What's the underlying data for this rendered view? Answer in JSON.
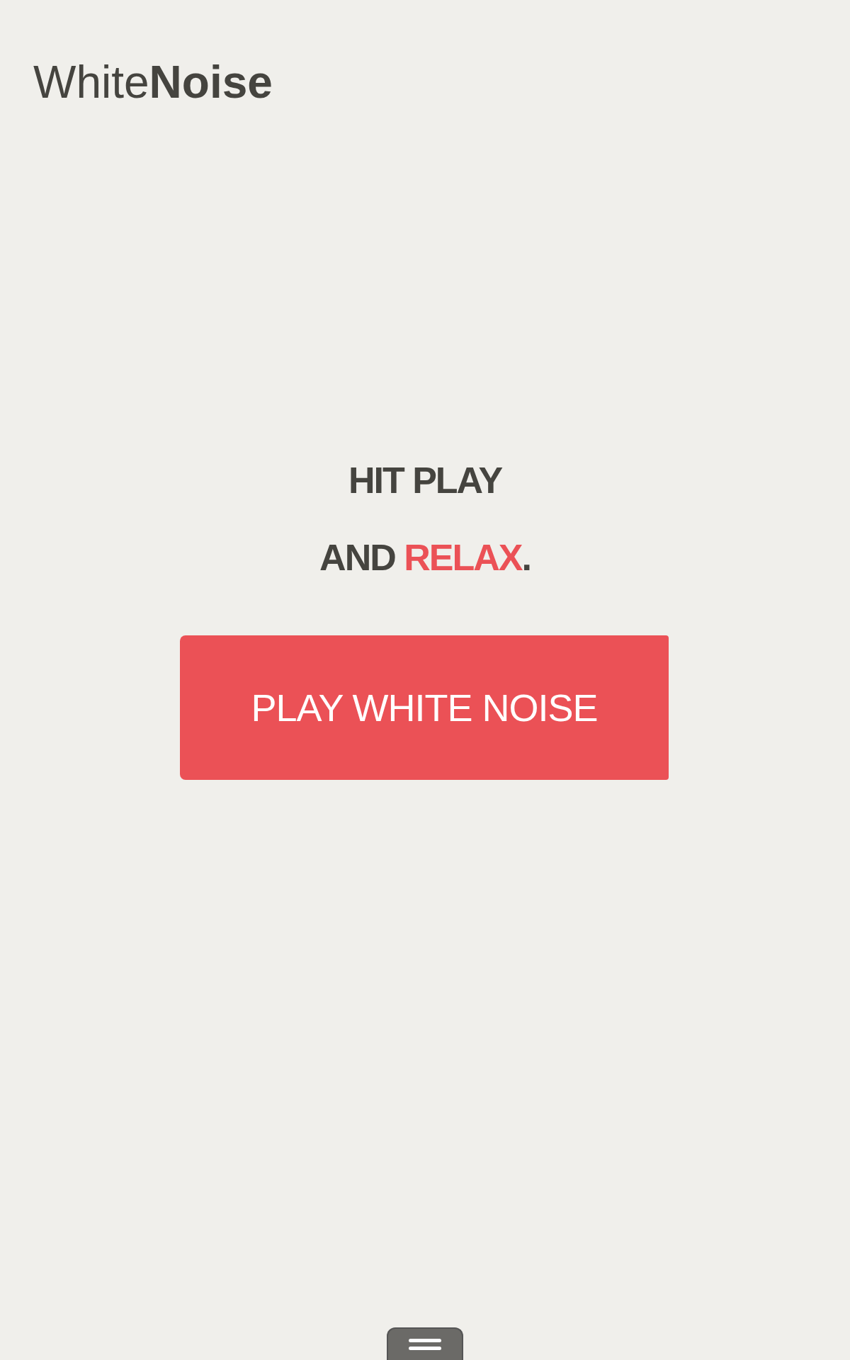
{
  "app_title": "White**Noise**",
  "headline": [
    [
      {
        "text": "HIT PLAY",
        "highlighted": false
      }
    ],
    [
      {
        "text": "AND ",
        "highlighted": false
      },
      {
        "text": "RELAX",
        "highlighted": true
      },
      {
        "text": ".",
        "highlighted": false
      }
    ]
  ],
  "play_button": {
    "label": "PLAY WHITE NOISE"
  },
  "bottom_handle": {
    "kind": "menu"
  }
}
